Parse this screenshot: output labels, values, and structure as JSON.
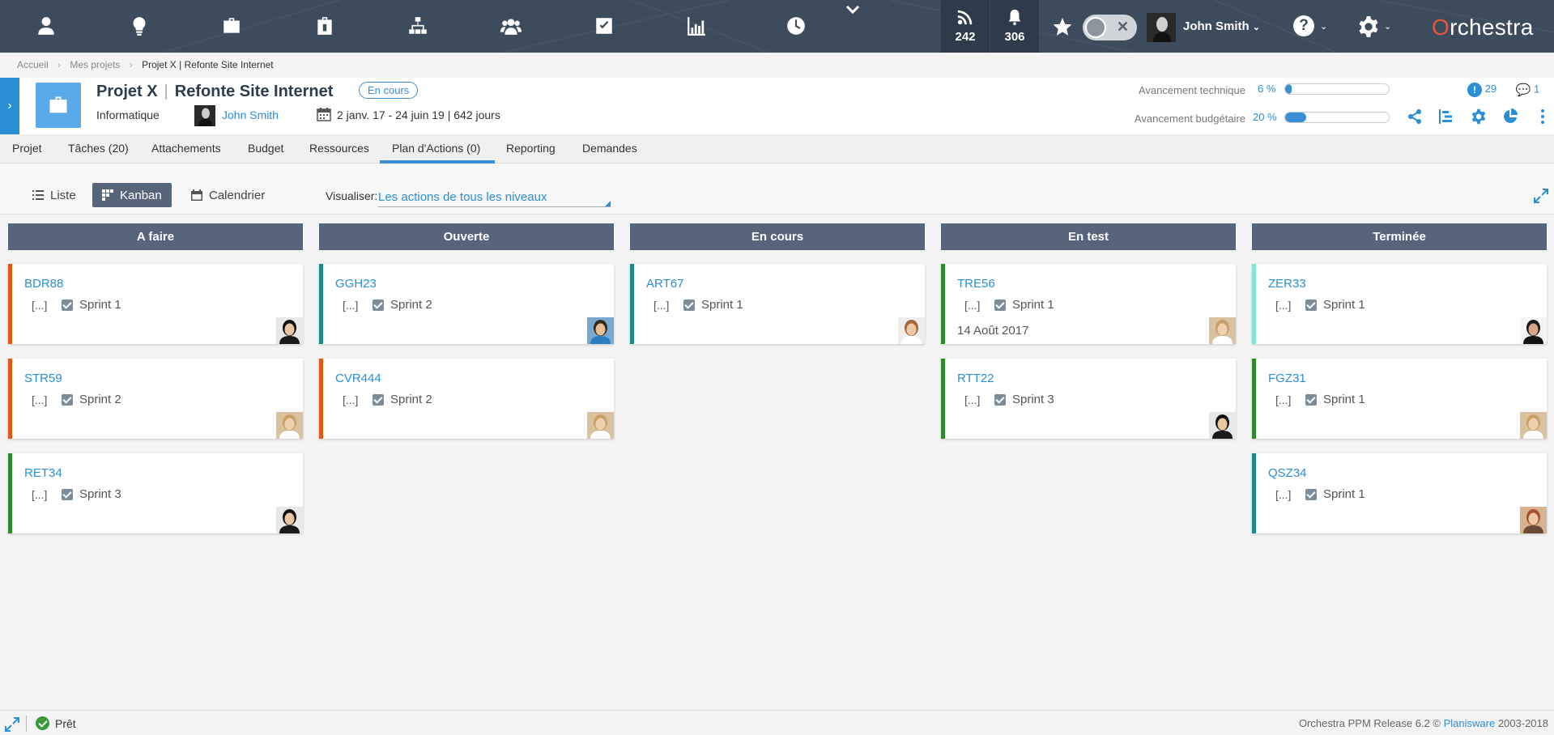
{
  "topbar": {
    "nav_icons": [
      "user-icon",
      "lightbulb-icon",
      "briefcase-icon",
      "project-case-icon",
      "org-chart-icon",
      "team-icon",
      "checkbox-icon",
      "chart-icon",
      "clock-icon"
    ],
    "feed_count": "242",
    "notif_count": "306",
    "user_name": "John Smith",
    "help_label": "?",
    "brand": "rchestra",
    "brand_o": "O"
  },
  "breadcrumb": [
    "Accueil",
    "Mes projets",
    "Projet X | Refonte Site Internet"
  ],
  "project": {
    "name": "Projet X",
    "subtitle": "Refonte Site Internet",
    "status": "En cours",
    "category": "Informatique",
    "manager": "John Smith",
    "dates": "2 janv. 17 - 24 juin 19 | 642 jours",
    "progress": [
      {
        "label": "Avancement technique",
        "value_text": "6 %",
        "fraction": 0.06
      },
      {
        "label": "Avancement budgétaire",
        "value_text": "20 %",
        "fraction": 0.2
      }
    ],
    "alerts_count": "29",
    "comments_count": "1"
  },
  "tabs": [
    "Projet",
    "Tâches (20)",
    "Attachements",
    "Budget",
    "Ressources",
    "Plan d'Actions (0)",
    "Reporting",
    "Demandes"
  ],
  "toolbar": {
    "views": [
      "Liste",
      "Kanban",
      "Calendrier"
    ],
    "active_view": "Kanban",
    "visualiser_label": "Visualiser:",
    "visualiser_value": "Les actions de tous les niveaux"
  },
  "kanban": {
    "columns": [
      {
        "title": "A faire",
        "cards": [
          {
            "code": "BDR88",
            "dots": "[...]",
            "sprint": "Sprint 1",
            "color": "#e05a12",
            "avatar": "asian-man"
          },
          {
            "code": "STR59",
            "dots": "[...]",
            "sprint": "Sprint 2",
            "color": "#e05a12",
            "avatar": "blonde-woman"
          },
          {
            "code": "RET34",
            "dots": "[...]",
            "sprint": "Sprint 3",
            "color": "#2d8a2d",
            "avatar": "asian-man"
          }
        ]
      },
      {
        "title": "Ouverte",
        "cards": [
          {
            "code": "GGH23",
            "dots": "[...]",
            "sprint": "Sprint 2",
            "color": "#1a8a8a",
            "avatar": "blue-man"
          },
          {
            "code": "CVR444",
            "dots": "[...]",
            "sprint": "Sprint 2",
            "color": "#e05a12",
            "avatar": "blonde-woman"
          }
        ]
      },
      {
        "title": "En cours",
        "cards": [
          {
            "code": "ART67",
            "dots": "[...]",
            "sprint": "Sprint 1",
            "color": "#1a8a8a",
            "avatar": "curly-woman"
          }
        ]
      },
      {
        "title": "En test",
        "cards": [
          {
            "code": "TRE56",
            "dots": "[...]",
            "sprint": "Sprint 1",
            "date": "14 Août 2017",
            "color": "#2d8a2d",
            "avatar": "blonde-woman"
          },
          {
            "code": "RTT22",
            "dots": "[...]",
            "sprint": "Sprint 3",
            "color": "#2d8a2d",
            "avatar": "asian-man"
          }
        ]
      },
      {
        "title": "Terminée",
        "cards": [
          {
            "code": "ZER33",
            "dots": "[...]",
            "sprint": "Sprint 1",
            "color": "#7fe8d8",
            "avatar": "dark-woman"
          },
          {
            "code": "FGZ31",
            "dots": "[...]",
            "sprint": "Sprint 1",
            "color": "#2d8a2d",
            "avatar": "blonde-woman"
          },
          {
            "code": "QSZ34",
            "dots": "[...]",
            "sprint": "Sprint 1",
            "color": "#1a8a8a",
            "avatar": "red-woman"
          }
        ]
      }
    ]
  },
  "footer": {
    "status": "Prêt",
    "release_prefix": "Orchestra PPM Release 6.2 ©",
    "release_company": "Planisware",
    "release_years": "2003-2018"
  }
}
